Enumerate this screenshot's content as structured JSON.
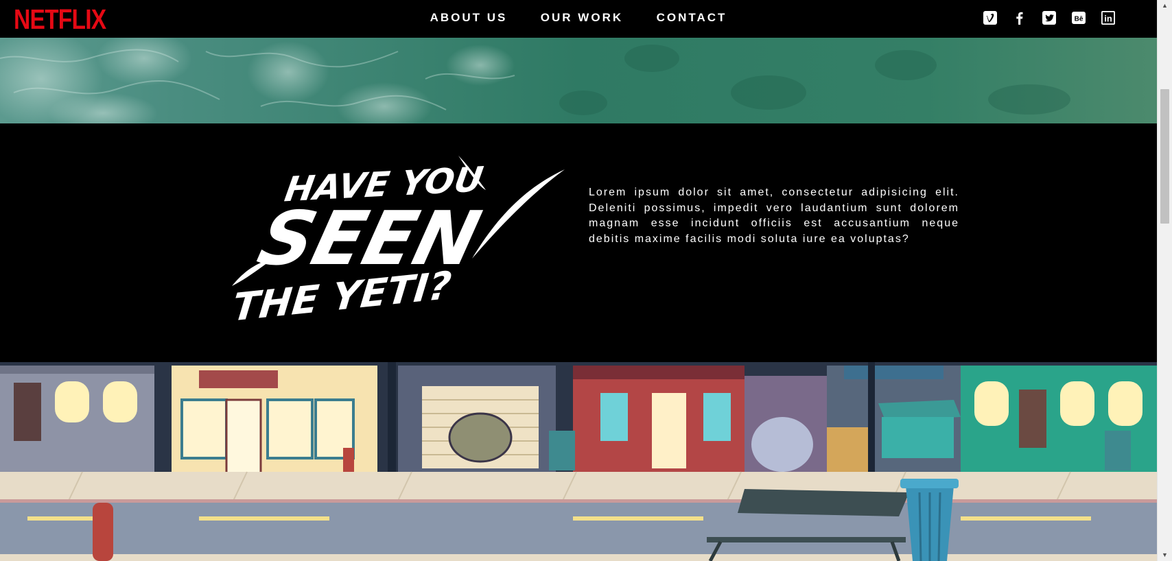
{
  "brand": {
    "logo_text": "NETFLIX",
    "logo_color": "#e50914"
  },
  "nav": {
    "links": [
      {
        "label": "ABOUT US"
      },
      {
        "label": "OUR WORK"
      },
      {
        "label": "CONTACT"
      }
    ],
    "social_icons": [
      "vimeo-icon",
      "facebook-icon",
      "twitter-icon",
      "behance-icon",
      "linkedin-icon"
    ],
    "social_labels": {
      "behance": "Bē",
      "linkedin": "in"
    }
  },
  "feature": {
    "title_lines": [
      "HAVE YOU",
      "SEEN",
      "THE YETI?"
    ],
    "body": "Lorem ipsum dolor sit amet, consectetur adipisicing elit. Deleniti possimus, impedit vero laudantium sunt dolorem magnam esse incidunt officiis est accusantium neque debitis maxime facilis modi soluta iure ea voluptas?"
  },
  "colors": {
    "background": "#000000",
    "text": "#ffffff",
    "ocean": "#3e8f78"
  }
}
